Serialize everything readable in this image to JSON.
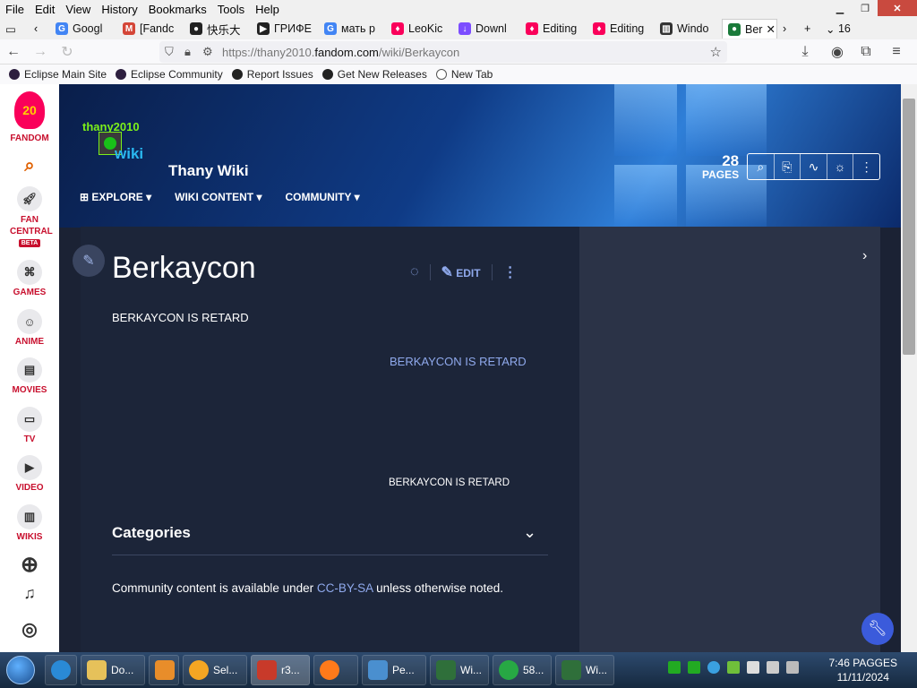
{
  "menubar": [
    "File",
    "Edit",
    "View",
    "History",
    "Bookmarks",
    "Tools",
    "Help"
  ],
  "tabs": [
    {
      "label": "Googl",
      "icon": "google-icon",
      "color": "#4285f4"
    },
    {
      "label": "[Fandc",
      "icon": "gmail-icon",
      "color": "#d44638"
    },
    {
      "label": "快乐大",
      "icon": "cat-icon",
      "color": "#222222"
    },
    {
      "label": "ГРИФЕ",
      "icon": "youtube-icon",
      "color": "#222222"
    },
    {
      "label": "мать р",
      "icon": "google-icon",
      "color": "#4285f4"
    },
    {
      "label": "LeoKic",
      "icon": "fandom-icon",
      "color": "#fa005a"
    },
    {
      "label": "Downl",
      "icon": "download-icon",
      "color": "#7c4dff"
    },
    {
      "label": "Editing",
      "icon": "fandom-icon",
      "color": "#fa005a"
    },
    {
      "label": "Editing",
      "icon": "fandom-icon",
      "color": "#fa005a"
    },
    {
      "label": "Windo",
      "icon": "archive-icon",
      "color": "#333333"
    },
    {
      "label": "Ber",
      "icon": "thany-icon",
      "color": "#1a7a3a",
      "active": true
    }
  ],
  "tab_count": "16",
  "url": {
    "prefix": "https://thany2010.",
    "domain": "fandom.com",
    "path": "/wiki/Berkaycon"
  },
  "bookmarks": [
    "Eclipse Main Site",
    "Eclipse Community",
    "Report Issues",
    "Get New Releases",
    "New Tab"
  ],
  "rail": {
    "brand": "FANDOM",
    "badge": "20",
    "items": [
      {
        "label": "FAN CENTRAL",
        "beta": "BETA",
        "icon": "rocket-icon"
      },
      {
        "label": "GAMES",
        "icon": "gamepad-icon"
      },
      {
        "label": "ANIME",
        "icon": "anime-icon"
      },
      {
        "label": "MOVIES",
        "icon": "clapper-icon"
      },
      {
        "label": "TV",
        "icon": "tv-icon"
      },
      {
        "label": "VIDEO",
        "icon": "video-icon"
      },
      {
        "label": "WIKIS",
        "icon": "book-icon"
      }
    ]
  },
  "wiki": {
    "logo_text_top": "thany2010",
    "logo_text_bottom": "wiki",
    "name": "Thany Wiki",
    "nav": [
      "EXPLORE",
      "WIKI CONTENT",
      "COMMUNITY"
    ],
    "page_count": "28",
    "page_count_label": "PAGES"
  },
  "article": {
    "title": "Berkaycon",
    "edit_label": "EDIT",
    "line1": "BERKAYCON IS RETARD",
    "line2": "BERKAYCON IS RETARD",
    "line3": "BERKAYCON IS RETARD",
    "categories": "Categories",
    "license_pre": "Community content is available under ",
    "license_link": "CC-BY-SA",
    "license_post": " unless otherwise noted."
  },
  "taskbar": {
    "items": [
      "Do...",
      "",
      "Sel...",
      "r3...",
      "",
      "Pe...",
      "Wi...",
      "58...",
      "Wi..."
    ],
    "clock_time": "7:46 PAGGES",
    "clock_date": "11/11/2024"
  },
  "colors": {
    "accent": "#8fa9ec",
    "fandom_red": "#c8102e",
    "content_bg": "#1c2539"
  }
}
